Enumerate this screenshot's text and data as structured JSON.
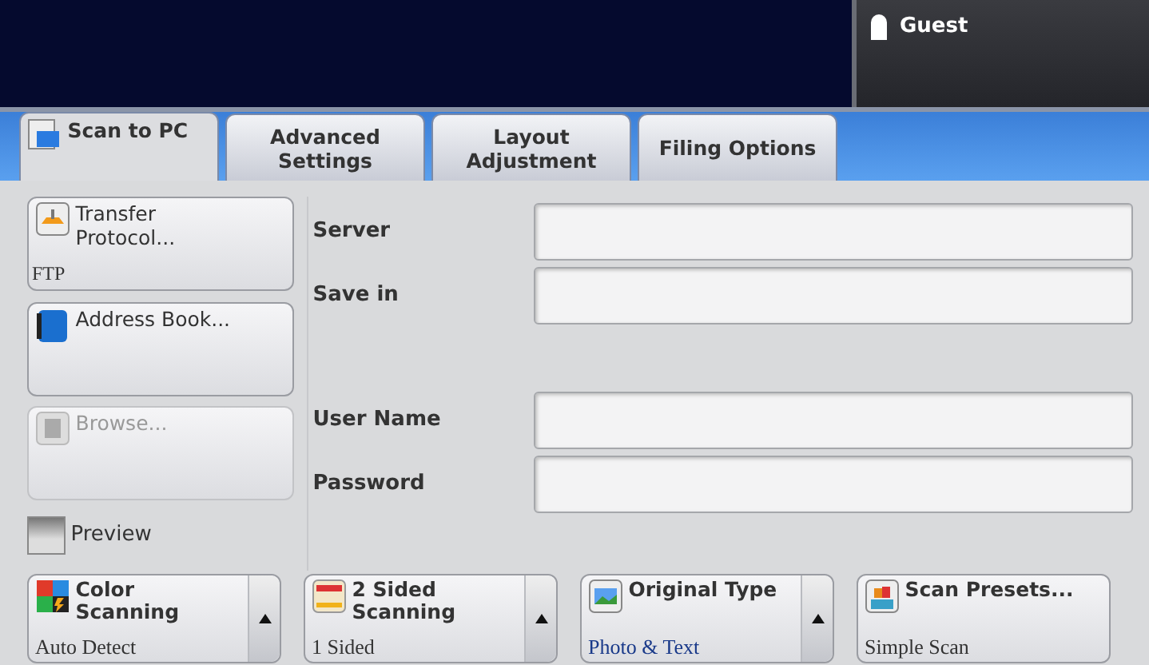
{
  "header": {
    "user": "Guest"
  },
  "tabs": [
    {
      "label": "Scan to PC",
      "selected": true
    },
    {
      "label": "Advanced Settings",
      "selected": false
    },
    {
      "label": "Layout Adjustment",
      "selected": false
    },
    {
      "label": "Filing Options",
      "selected": false
    }
  ],
  "side_controls": [
    {
      "kind": "button",
      "label": "Transfer Protocol...",
      "value": "FTP",
      "disabled": false
    },
    {
      "kind": "button",
      "label": "Address Book...",
      "disabled": false
    },
    {
      "kind": "button",
      "label": "Browse...",
      "disabled": true
    },
    {
      "kind": "checkbox",
      "label": "Preview",
      "checked": false
    }
  ],
  "fields": [
    {
      "label": "Server"
    },
    {
      "label": "Save in"
    },
    {
      "label": "User Name"
    },
    {
      "label": "Password"
    }
  ],
  "feature_buttons": [
    {
      "title": "Color Scanning",
      "value": "Auto Detect"
    },
    {
      "title": "2 Sided Scanning",
      "value": "1 Sided"
    },
    {
      "title": "Original Type",
      "value": "Photo & Text"
    },
    {
      "title": "Scan Presets...",
      "value": "Simple Scan"
    }
  ]
}
